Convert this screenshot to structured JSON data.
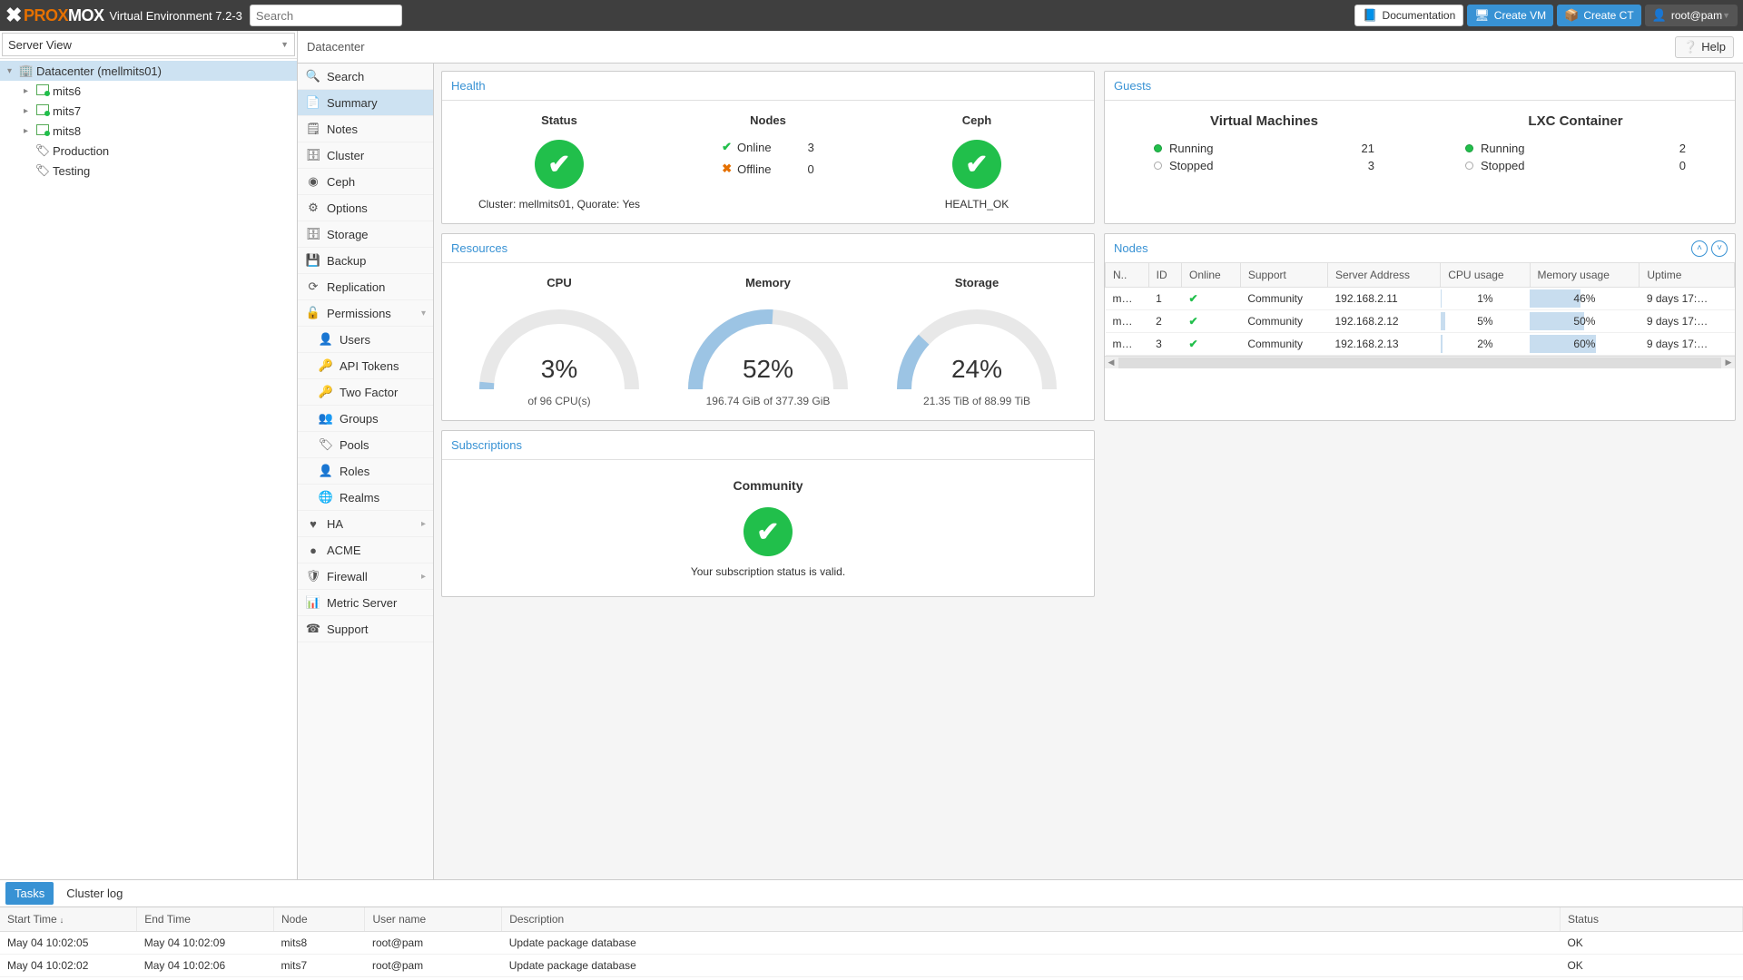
{
  "header": {
    "product": {
      "prox": "PROX",
      "mox": "MOX"
    },
    "ve_label": "Virtual Environment 7.2-3",
    "search_placeholder": "Search",
    "doc_label": "Documentation",
    "create_vm_label": "Create VM",
    "create_ct_label": "Create CT",
    "user_label": "root@pam"
  },
  "view_selector": "Server View",
  "tree": {
    "root": "Datacenter (mellmits01)",
    "nodes": [
      "mits6",
      "mits7",
      "mits8"
    ],
    "pools": [
      "Production",
      "Testing"
    ]
  },
  "crumb": "Datacenter",
  "help_label": "Help",
  "innernav": [
    {
      "icon": "🔍",
      "label": "Search",
      "sub": false
    },
    {
      "icon": "📄",
      "label": "Summary",
      "sub": false,
      "active": true
    },
    {
      "icon": "🗒",
      "label": "Notes",
      "sub": false
    },
    {
      "icon": "🗄",
      "label": "Cluster",
      "sub": false
    },
    {
      "icon": "◉",
      "label": "Ceph",
      "sub": false
    },
    {
      "icon": "⚙",
      "label": "Options",
      "sub": false
    },
    {
      "icon": "🗄",
      "label": "Storage",
      "sub": false
    },
    {
      "icon": "💾",
      "label": "Backup",
      "sub": false
    },
    {
      "icon": "⟳",
      "label": "Replication",
      "sub": false
    },
    {
      "icon": "🔓",
      "label": "Permissions",
      "sub": false,
      "exp": "▾"
    },
    {
      "icon": "👤",
      "label": "Users",
      "sub": true
    },
    {
      "icon": "🔑",
      "label": "API Tokens",
      "sub": true
    },
    {
      "icon": "🔑",
      "label": "Two Factor",
      "sub": true
    },
    {
      "icon": "👥",
      "label": "Groups",
      "sub": true
    },
    {
      "icon": "🏷",
      "label": "Pools",
      "sub": true
    },
    {
      "icon": "👤",
      "label": "Roles",
      "sub": true
    },
    {
      "icon": "🌐",
      "label": "Realms",
      "sub": true
    },
    {
      "icon": "♥",
      "label": "HA",
      "sub": false,
      "exp": "▸"
    },
    {
      "icon": "●",
      "label": "ACME",
      "sub": false
    },
    {
      "icon": "🛡",
      "label": "Firewall",
      "sub": false,
      "exp": "▸"
    },
    {
      "icon": "📊",
      "label": "Metric Server",
      "sub": false
    },
    {
      "icon": "☎",
      "label": "Support",
      "sub": false
    }
  ],
  "health": {
    "title": "Health",
    "status_label": "Status",
    "nodes_label": "Nodes",
    "ceph_label": "Ceph",
    "cluster_line": "Cluster: mellmits01, Quorate: Yes",
    "online_label": "Online",
    "online_count": "3",
    "offline_label": "Offline",
    "offline_count": "0",
    "ceph_status": "HEALTH_OK"
  },
  "guests": {
    "title": "Guests",
    "vm_title": "Virtual Machines",
    "lxc_title": "LXC Container",
    "running_label": "Running",
    "stopped_label": "Stopped",
    "vm_running": "21",
    "vm_stopped": "3",
    "lxc_running": "2",
    "lxc_stopped": "0"
  },
  "resources": {
    "title": "Resources",
    "cpu": {
      "label": "CPU",
      "pct": "3%",
      "sub": "of 96 CPU(s)",
      "frac": 0.03
    },
    "mem": {
      "label": "Memory",
      "pct": "52%",
      "sub": "196.74 GiB of 377.39 GiB",
      "frac": 0.52
    },
    "sto": {
      "label": "Storage",
      "pct": "24%",
      "sub": "21.35 TiB of 88.99 TiB",
      "frac": 0.24
    }
  },
  "chart_data": [
    {
      "type": "bar",
      "title": "CPU",
      "categories": [
        "CPU"
      ],
      "values": [
        3
      ],
      "ylabel": "% of 96 CPU(s)",
      "ylim": [
        0,
        100
      ]
    },
    {
      "type": "bar",
      "title": "Memory",
      "categories": [
        "Memory"
      ],
      "values": [
        52
      ],
      "ylabel": "% of 377.39 GiB",
      "ylim": [
        0,
        100
      ]
    },
    {
      "type": "bar",
      "title": "Storage",
      "categories": [
        "Storage"
      ],
      "values": [
        24
      ],
      "ylabel": "% of 88.99 TiB",
      "ylim": [
        0,
        100
      ]
    }
  ],
  "nodes_panel": {
    "title": "Nodes",
    "cols": [
      "N..",
      "ID",
      "Online",
      "Support",
      "Server Address",
      "CPU usage",
      "Memory usage",
      "Uptime"
    ],
    "rows": [
      {
        "name": "m…",
        "id": "1",
        "online": true,
        "support": "Community",
        "addr": "192.168.2.11",
        "cpu": "1%",
        "cpu_frac": 0.01,
        "mem": "46%",
        "mem_frac": 0.46,
        "uptime": "9 days 17:…"
      },
      {
        "name": "m…",
        "id": "2",
        "online": true,
        "support": "Community",
        "addr": "192.168.2.12",
        "cpu": "5%",
        "cpu_frac": 0.05,
        "mem": "50%",
        "mem_frac": 0.5,
        "uptime": "9 days 17:…"
      },
      {
        "name": "m…",
        "id": "3",
        "online": true,
        "support": "Community",
        "addr": "192.168.2.13",
        "cpu": "2%",
        "cpu_frac": 0.02,
        "mem": "60%",
        "mem_frac": 0.6,
        "uptime": "9 days 17:…"
      }
    ]
  },
  "subscriptions": {
    "title": "Subscriptions",
    "level": "Community",
    "msg": "Your subscription status is valid."
  },
  "bottom": {
    "tabs": [
      "Tasks",
      "Cluster log"
    ],
    "cols": [
      "Start Time",
      "End Time",
      "Node",
      "User name",
      "Description",
      "Status"
    ],
    "rows": [
      {
        "start": "May 04 10:02:05",
        "end": "May 04 10:02:09",
        "node": "mits8",
        "user": "root@pam",
        "desc": "Update package database",
        "status": "OK"
      },
      {
        "start": "May 04 10:02:02",
        "end": "May 04 10:02:06",
        "node": "mits7",
        "user": "root@pam",
        "desc": "Update package database",
        "status": "OK"
      }
    ]
  }
}
